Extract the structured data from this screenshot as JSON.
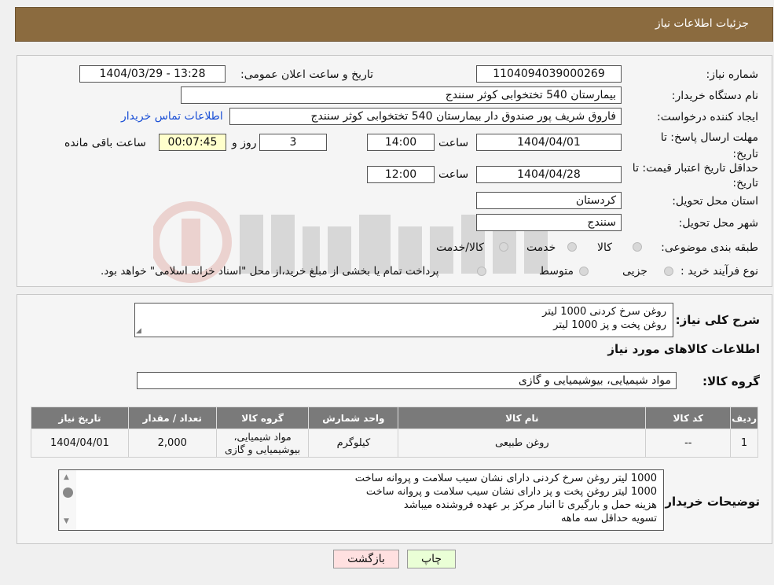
{
  "header": {
    "title": "جزئیات اطلاعات نیاز"
  },
  "form": {
    "need_number_label": "شماره نیاز:",
    "need_number": "1104094039000269",
    "announce_label": "تاریخ و ساعت اعلان عمومی:",
    "announce_value": "1404/03/29 - 13:28",
    "buyer_org_label": "نام دستگاه خریدار:",
    "buyer_org": "بیمارستان 540 تختخوابی کوثر سنندج",
    "creator_label": "ایجاد کننده درخواست:",
    "creator": "فاروق شریف پور صندوق دار بیمارستان 540 تختخوابی کوثر سنندج",
    "contact_link": "اطلاعات تماس خریدار",
    "deadline_label": "مهلت ارسال پاسخ: تا تاریخ:",
    "deadline_date": "1404/04/01",
    "time_label": "ساعت",
    "deadline_time": "14:00",
    "days_value": "3",
    "days_label": "روز و",
    "remaining_time": "00:07:45",
    "remaining_label": "ساعت باقی مانده",
    "validity_label": "حداقل تاریخ اعتبار قیمت: تا تاریخ:",
    "validity_date": "1404/04/28",
    "validity_time": "12:00",
    "province_label": "استان محل تحویل:",
    "province": "کردستان",
    "city_label": "شهر محل تحویل:",
    "city": "سنندج",
    "category_label": "طبقه بندی موضوعی:",
    "category_options": [
      "کالا",
      "خدمت",
      "کالا/خدمت"
    ],
    "process_label": "نوع فرآیند خرید :",
    "process_options": [
      "جزیی",
      "متوسط"
    ],
    "process_note": "پرداخت تمام یا بخشی از مبلغ خرید،از محل \"اسناد خزانه اسلامی\" خواهد بود."
  },
  "summary": {
    "label": "شرح کلی نیاز:",
    "lines": [
      "روغن سرخ کردنی 1000 لیتر",
      "روغن پخت و پز 1000 لیتر"
    ]
  },
  "goods": {
    "title": "اطلاعات کالاهای مورد نیاز",
    "group_label": "گروه کالا:",
    "group_value": "مواد شیمیایی، بیوشیمیایی و  گازی",
    "columns": [
      "ردیف",
      "کد کالا",
      "نام کالا",
      "واحد شمارش",
      "گروه کالا",
      "تعداد / مقدار",
      "تاریخ نیاز"
    ],
    "rows": [
      {
        "row": "1",
        "code": "--",
        "name": "روغن طبیعی",
        "unit": "کیلوگرم",
        "group_line1": "مواد شیمیایی،",
        "group_line2": "بیوشیمیایی و گازی",
        "qty": "2,000",
        "date": "1404/04/01"
      }
    ]
  },
  "buyer_notes": {
    "label": "توضیحات خریدار:",
    "lines": [
      "1000 لیتر روغن سرخ کردنی دارای نشان سیب سلامت و پروانه ساخت",
      "1000 لیتر روغن پخت و پز دارای نشان سیب سلامت و پروانه ساخت",
      "هزینه حمل و بارگیری تا انبار مرکز بر عهده فروشنده میباشد",
      "تسویه حداقل سه ماهه"
    ]
  },
  "buttons": {
    "print": "چاپ",
    "back": "بازگشت"
  },
  "colors": {
    "header_bg": "#8b6b3f",
    "link": "#1a4fd6",
    "print_btn": "#eaffd6",
    "back_btn": "#ffe0e0"
  }
}
